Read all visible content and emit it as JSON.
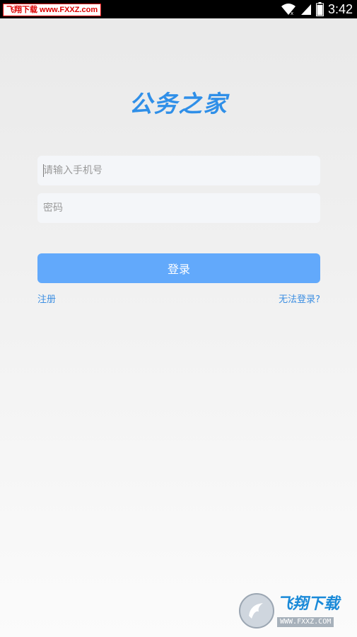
{
  "status_bar": {
    "watermark": "飞翔下载 www.FXXZ.com",
    "time": "3:42",
    "icons": [
      "wifi-icon",
      "signal-icon",
      "battery-icon"
    ]
  },
  "app": {
    "title": "公务之家"
  },
  "form": {
    "phone_placeholder": "请输入手机号",
    "password_placeholder": "密码",
    "login_label": "登录",
    "register_label": "注册",
    "forgot_label": "无法登录?"
  },
  "watermark": {
    "text": "飞翔下载",
    "url": "WWW.FXXZ.COM"
  },
  "colors": {
    "accent": "#62a9fb",
    "title": "#2f8fe8",
    "link": "#3d8fe2",
    "status_bar": "#000000"
  }
}
